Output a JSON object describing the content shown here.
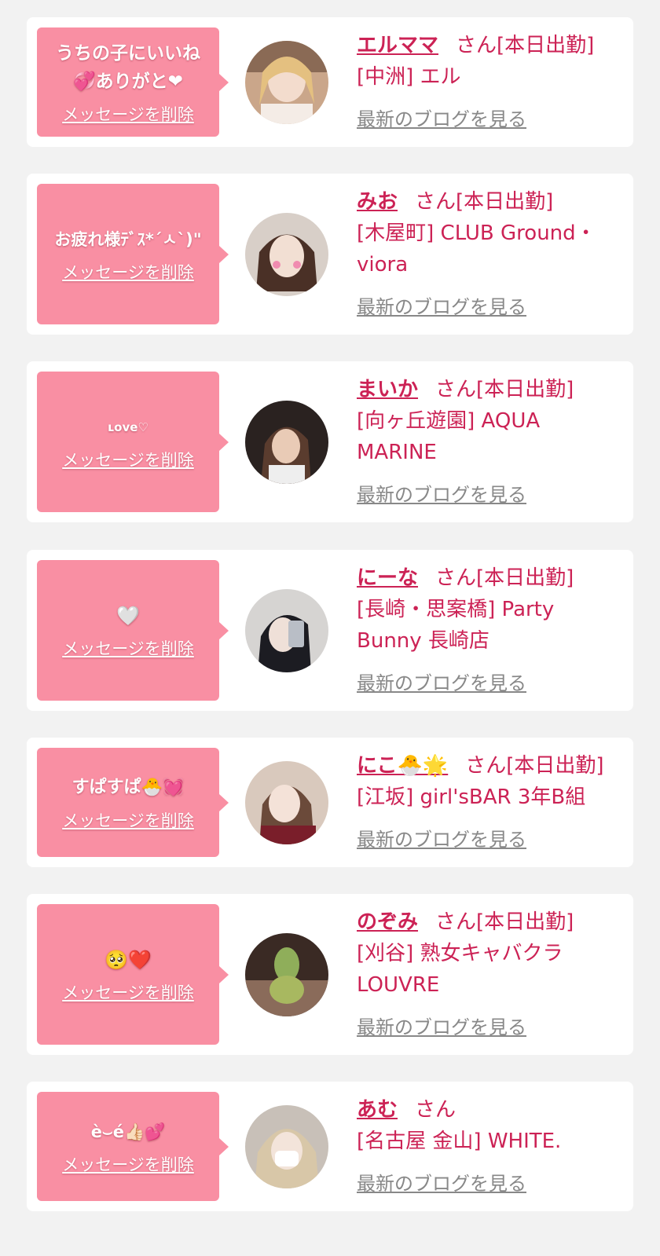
{
  "colors": {
    "accent": "#cc2255",
    "bubble": "#f98fa3",
    "link_gray": "#888888"
  },
  "labels": {
    "delete_message": "メッセージを削除",
    "latest_blog": "最新のブログを見る",
    "honorific": "さん",
    "on_duty": "[本日出勤]"
  },
  "cards": [
    {
      "message_line1": "うちの子にいいね",
      "message_line2": "💞ありがと❤",
      "name": "エルママ",
      "on_duty": "[本日出勤]",
      "shop": "[中洲] エル"
    },
    {
      "message": "お疲れ様ﾃﾞｽ*´ㅅ`)\"",
      "name": "みお",
      "on_duty": "[本日出勤]",
      "shop": "[木屋町] CLUB Ground・viora"
    },
    {
      "message": "ʟove♡",
      "name": "まいか",
      "on_duty": "[本日出勤]",
      "shop": "[向ヶ丘遊園] AQUA MARINE"
    },
    {
      "message": "🤍",
      "name": "にーな",
      "on_duty": "[本日出勤]",
      "shop": "[長崎・思案橋] Party Bunny 長崎店"
    },
    {
      "message": "すぱすぱ🐣💓",
      "name": "にこ🐣🌟",
      "on_duty": "[本日出勤]",
      "shop": "[江坂] girl'sBAR 3年B組"
    },
    {
      "message": "🥺❤️",
      "name": "のぞみ",
      "on_duty": "[本日出勤]",
      "shop": "[刈谷] 熟女キャバクラ LOUVRE"
    },
    {
      "message": "è⌣é👍🏻💕",
      "name": "あむ",
      "on_duty": "",
      "shop": "[名古屋 金山] WHITE."
    }
  ]
}
